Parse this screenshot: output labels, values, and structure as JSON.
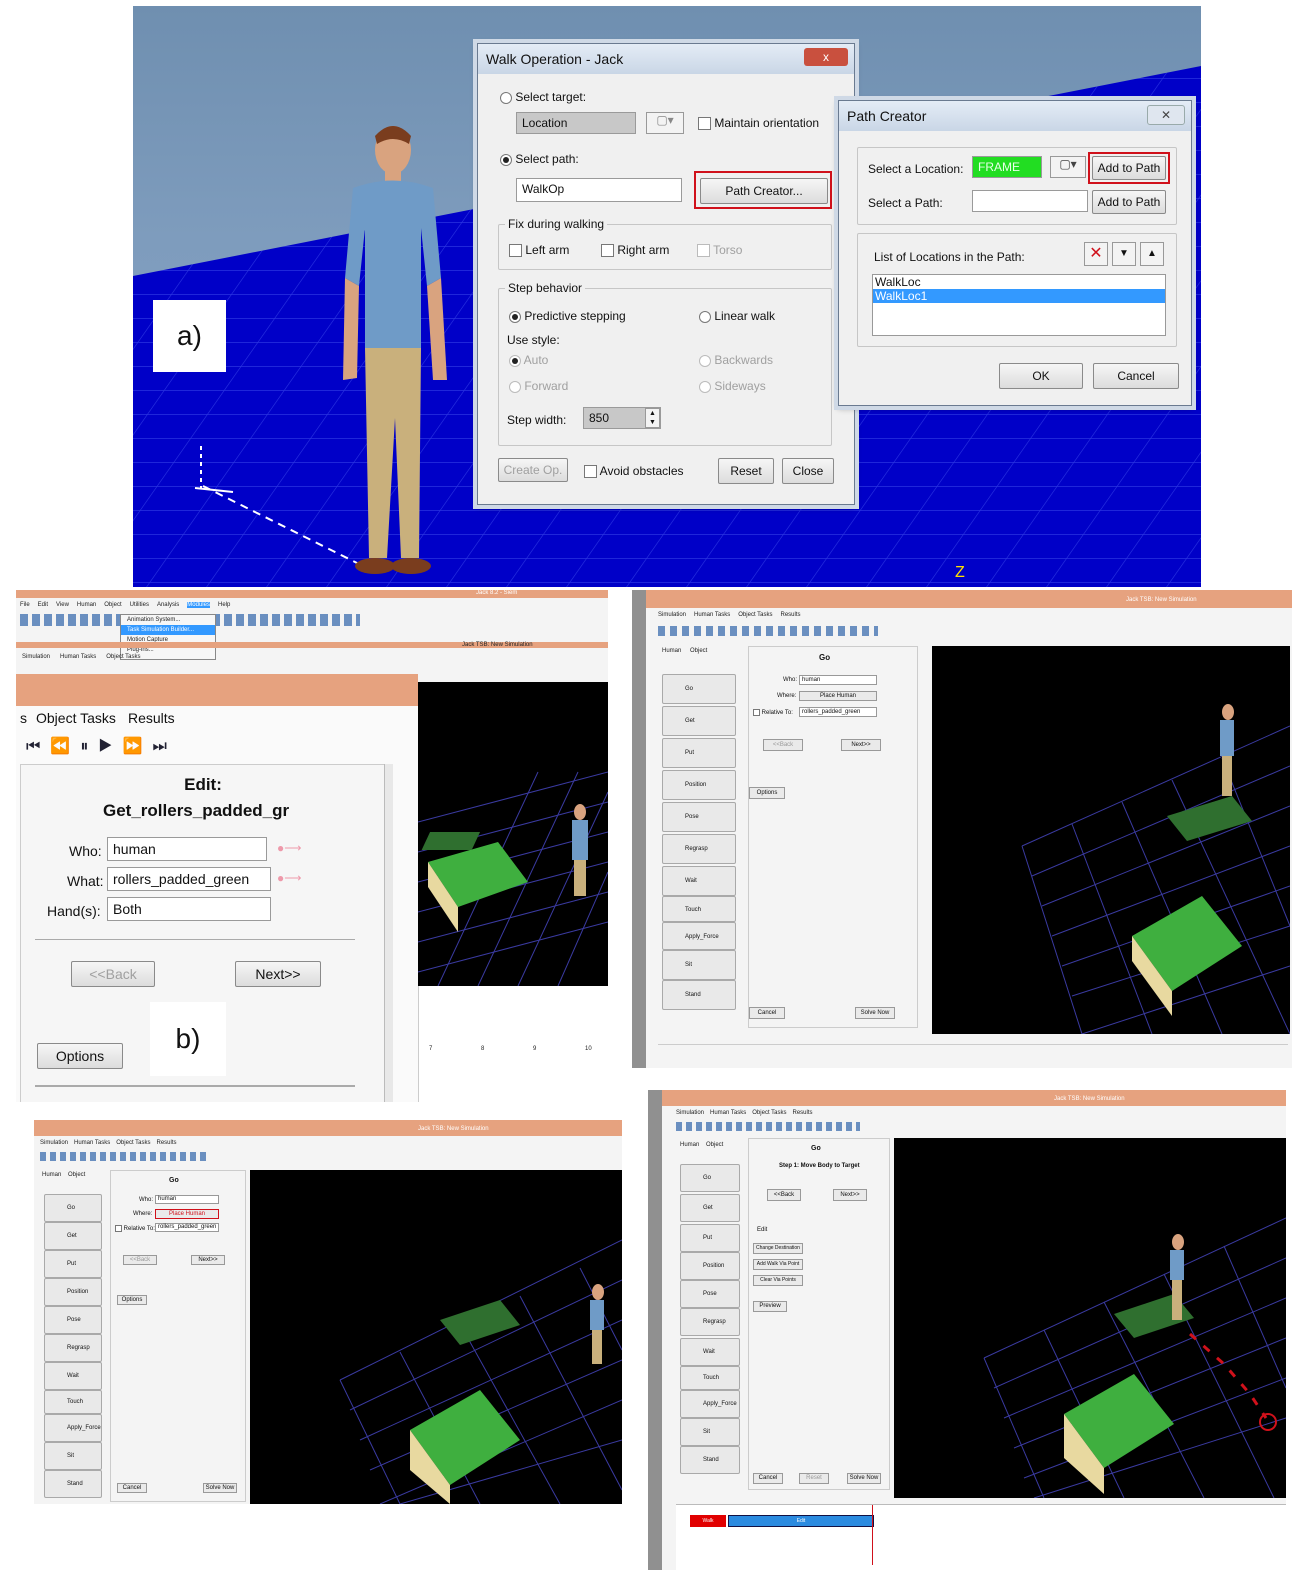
{
  "panel_a": {
    "label": "a)",
    "axis_label": "Z",
    "walk_dialog": {
      "title": "Walk Operation - Jack",
      "close_glyph": "x",
      "select_target_label": "Select target:",
      "target_value": "Location",
      "maintain_orientation_label": "Maintain orientation",
      "select_path_label": "Select path:",
      "path_value": "WalkOp",
      "path_creator_button": "Path Creator...",
      "fix_group_title": "Fix during walking",
      "left_arm_label": "Left arm",
      "right_arm_label": "Right arm",
      "torso_label": "Torso",
      "step_group_title": "Step behavior",
      "predictive_label": "Predictive stepping",
      "linear_label": "Linear walk",
      "use_style_label": "Use style:",
      "auto_label": "Auto",
      "backwards_label": "Backwards",
      "forward_label": "Forward",
      "sideways_label": "Sideways",
      "step_width_label": "Step width:",
      "step_width_value": "850",
      "create_op_button": "Create Op.",
      "avoid_obstacles_label": "Avoid obstacles",
      "reset_button": "Reset",
      "close_button": "Close"
    },
    "path_dialog": {
      "title": "Path Creator",
      "close_glyph": "✕",
      "select_location_label": "Select a Location:",
      "location_value": "FRAME",
      "add_to_path_button_1": "Add to Path",
      "select_path_label": "Select a Path:",
      "add_to_path_button_2": "Add to Path",
      "list_label": "List of Locations in the Path:",
      "delete_glyph": "✕",
      "down_glyph": "▼",
      "up_glyph": "▲",
      "list_items": [
        "WalkLoc",
        "WalkLoc1"
      ],
      "ok_button": "OK",
      "cancel_button": "Cancel"
    }
  },
  "panel_b": {
    "label": "b)",
    "top_left": {
      "menubar": [
        "File",
        "Edit",
        "View",
        "Human",
        "Object",
        "Utilities",
        "Analysis",
        "Modules",
        "Help"
      ],
      "window_title": "Jack 8.2 - Siem",
      "sub_title": "Jack TSB: New Simulation",
      "modules_menu": [
        "Animation System...",
        "Task Simulation Builder...",
        "Motion Capture",
        "Plug-ins..."
      ],
      "sub_menubar": [
        "Simulation",
        "Human Tasks",
        "Object Tasks"
      ],
      "tabs_zoom": [
        "s",
        "Object Tasks",
        "Results"
      ],
      "edit_heading": "Edit:",
      "edit_name": "Get_rollers_padded_gr",
      "who_label": "Who:",
      "who_value": "human",
      "what_label": "What:",
      "what_value": "rollers_padded_green",
      "hands_label": "Hand(s):",
      "hands_value": "Both",
      "back_button": "<<Back",
      "next_button": "Next>>",
      "options_button": "Options",
      "ticks": [
        "7",
        "8",
        "9",
        "10"
      ]
    },
    "sim_window_title": "Jack TSB: New Simulation",
    "sim_menubar": [
      "Simulation",
      "Human Tasks",
      "Object Tasks",
      "Results"
    ],
    "side_tabs": [
      "Human",
      "Object"
    ],
    "task_buttons": [
      "Go",
      "Get",
      "Put",
      "Position",
      "Pose",
      "Regrasp",
      "Wait",
      "Touch",
      "Apply_Force",
      "Sit",
      "Stand"
    ],
    "go_form": {
      "heading": "Go",
      "who_label": "Who:",
      "who_value": "human",
      "where_label": "Where:",
      "where_button": "Place Human",
      "relative_label": "Relative To:",
      "relative_value": "rollers_padded_green",
      "back_button": "<<Back",
      "next_button": "Next>>",
      "options_button": "Options",
      "cancel_button": "Cancel",
      "solve_button": "Solve Now"
    },
    "step_form": {
      "heading": "Go",
      "step_title": "Step 1: Move Body to Target",
      "back_button": "<<Back",
      "next_button": "Next>>",
      "edit_label": "Edit",
      "change_destination": "Change Destination",
      "add_walk_via": "Add Walk Via Point",
      "clear_via": "Clear Via Points",
      "preview_button": "Preview",
      "cancel_button": "Cancel",
      "reset_button": "Reset",
      "solve_button": "Solve Now",
      "timeline_label_red": "Walk",
      "timeline_label_blue": "Edit"
    }
  },
  "colors": {
    "floor_blue": "#0000c8",
    "highlight_red": "#d0111b",
    "frame_green": "#22dd22",
    "selection_blue": "#3399ff",
    "title_orange": "#e6a27f"
  }
}
